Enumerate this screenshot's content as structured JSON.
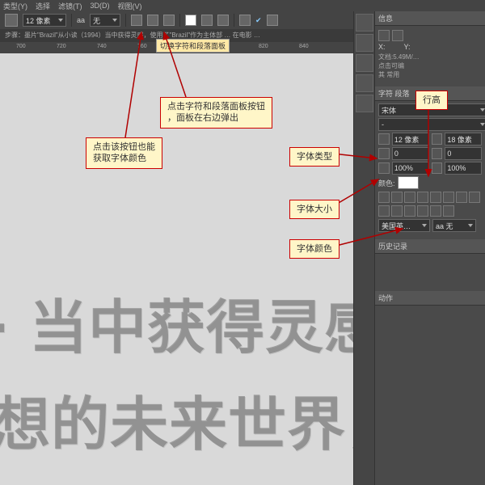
{
  "menu": {
    "items": [
      "类型(Y)",
      "选择",
      "滤镜(T)",
      "3D(D)",
      "视图(V)"
    ]
  },
  "font_size_tool": "12 像素",
  "aa": {
    "label": "aa",
    "value": "无"
  },
  "tabbar": "步骤：墨片\"Brazil\"从小读（1994）当中获得灵感，使用了\"Brazil\"作为主体部 … 在电影 …",
  "tooltip": "切换字符和段落面板",
  "callouts": {
    "c1": "点击该按钮也能\n获取字体颜色",
    "c2": "点击字符和段落面板按钮\n，面板在右边弹出",
    "c3": "行高",
    "c4": "字体类型",
    "c5": "字体大小",
    "c6": "字体颜色"
  },
  "char_panel": {
    "tabs": "字符  段落",
    "font_family": "宋体",
    "font_style": "-",
    "font_size": "12 像素",
    "leading": "18 像素",
    "tracking": "0",
    "scale_v": "100%",
    "scale_h": "100%",
    "color_label": "颜色:",
    "bottom_aa": "aa 无",
    "lang": "美国英…"
  },
  "right_labels": {
    "info": "信息",
    "x": "X:",
    "y": "Y:",
    "doc": "文档:5.49M/…",
    "hintA": "点击可编",
    "hintB": "其 常用",
    "history": "历史记录",
    "action": "动作"
  },
  "canvas_line1": "· 当中获得灵感，使用",
  "canvas_line2": "想的未来世界，人们生活"
}
